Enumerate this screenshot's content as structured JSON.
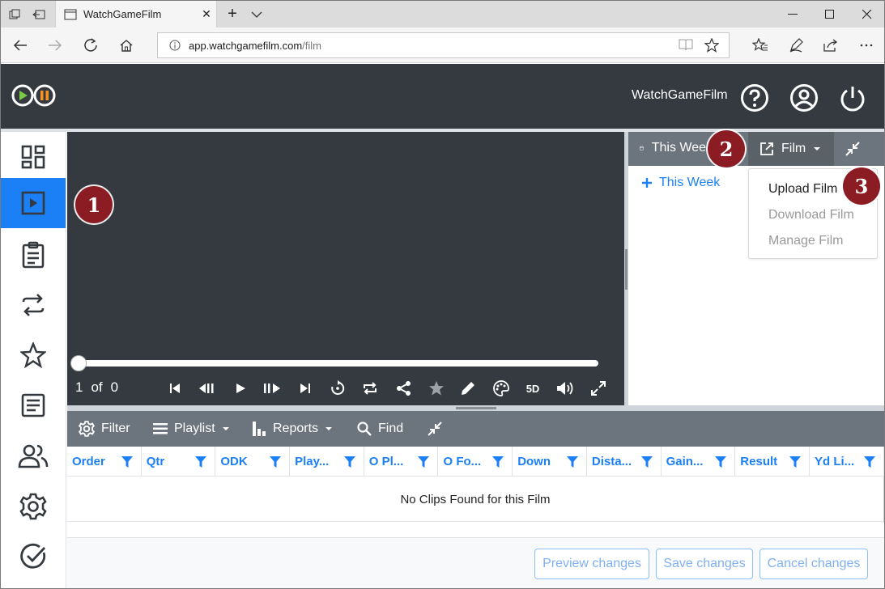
{
  "browser": {
    "tab_title": "WatchGameFilm",
    "url_host": "app.watchgamefilm.com",
    "url_path": "/film"
  },
  "header": {
    "brand": "WatchGameFilm"
  },
  "player": {
    "current": "1",
    "of": "of",
    "total": "0",
    "speed": "5D",
    "seek_position": 0
  },
  "panel": {
    "week_label": "This Week",
    "film_label": "Film",
    "add_week": "This Week",
    "menu": [
      "Upload Film",
      "Download Film",
      "Manage Film"
    ]
  },
  "badges": [
    "1",
    "2",
    "3"
  ],
  "toolbar": {
    "filter": "Filter",
    "playlist": "Playlist",
    "reports": "Reports",
    "find": "Find"
  },
  "table": {
    "columns": [
      "Order",
      "Qtr",
      "ODK",
      "Play...",
      "O Pl...",
      "O Fo...",
      "Down",
      "Dista...",
      "Gain...",
      "Result",
      "Yd Li..."
    ],
    "empty_message": "No Clips Found for this Film"
  },
  "footer": {
    "preview": "Preview changes",
    "save": "Save changes",
    "cancel": "Cancel changes"
  },
  "colors": {
    "header_bg": "#343a40",
    "accent": "#1b7ff5",
    "panel_bar": "#6c757d",
    "badge": "#8b1c24"
  }
}
